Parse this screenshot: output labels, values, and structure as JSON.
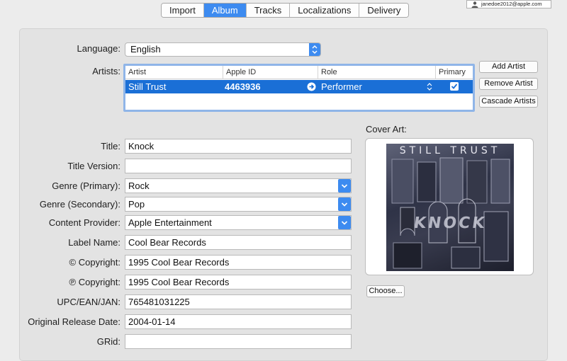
{
  "tabs": [
    {
      "label": "Import",
      "active": false
    },
    {
      "label": "Album",
      "active": true
    },
    {
      "label": "Tracks",
      "active": false
    },
    {
      "label": "Localizations",
      "active": false
    },
    {
      "label": "Delivery",
      "active": false
    }
  ],
  "user": {
    "email": "janedoe2012@apple.com"
  },
  "language": {
    "label": "Language:",
    "value": "English"
  },
  "artists": {
    "label": "Artists:",
    "columns": [
      "Artist",
      "Apple ID",
      "Role",
      "Primary"
    ],
    "rows": [
      {
        "artist": "Still Trust",
        "apple_id": "4463936",
        "role": "Performer",
        "primary": true
      }
    ],
    "buttons": {
      "add": "Add Artist",
      "remove": "Remove Artist",
      "cascade": "Cascade Artists"
    }
  },
  "fields": {
    "title": {
      "label": "Title:",
      "value": "Knock"
    },
    "title_version": {
      "label": "Title Version:",
      "value": ""
    },
    "genre_primary": {
      "label": "Genre (Primary):",
      "value": "Rock"
    },
    "genre_secondary": {
      "label": "Genre (Secondary):",
      "value": "Pop"
    },
    "content_provider": {
      "label": "Content Provider:",
      "value": "Apple Entertainment"
    },
    "label_name": {
      "label": "Label Name:",
      "value": "Cool Bear Records"
    },
    "copyright": {
      "label": "© Copyright:",
      "value": "1995 Cool Bear Records"
    },
    "p_copyright": {
      "label": "℗ Copyright:",
      "value": "1995 Cool Bear Records"
    },
    "upc": {
      "label": "UPC/EAN/JAN:",
      "value": "765481031225"
    },
    "original_release_date": {
      "label": "Original Release Date:",
      "value": "2004-01-14"
    },
    "grid": {
      "label": "GRid:",
      "value": ""
    }
  },
  "cover_art": {
    "label": "Cover Art:",
    "artwork_text_top": "STILL TRUST",
    "artwork_text_main": "KNOCK",
    "choose_label": "Choose..."
  },
  "colors": {
    "accent": "#3d8bf0",
    "selection": "#1a6fd6"
  }
}
